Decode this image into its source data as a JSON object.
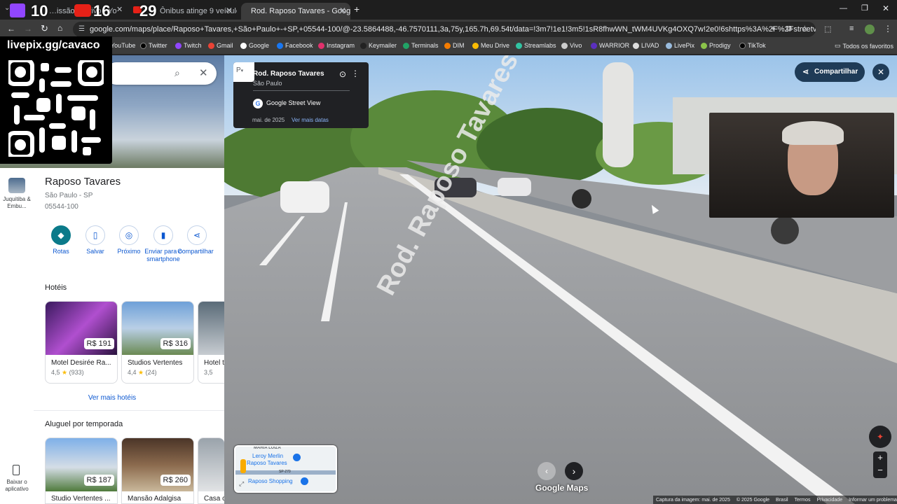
{
  "browser": {
    "tabs": [
      {
        "title": "…issão ao vivo - Yo",
        "active": false
      },
      {
        "title": "Ônibus atinge 9 veículos",
        "active": false
      },
      {
        "title": "Rod. Raposo Tavares - Google",
        "active": true
      }
    ],
    "overlay_counts": [
      "10",
      "16",
      "29"
    ],
    "new_tab": "+",
    "url": "google.com/maps/place/Raposo+Tavares,+São+Paulo+-+SP,+05544-100/@-23.5864488,-46.7570111,3a,75y,165.7h,69.54t/data=!3m7!1e1!3m5!1sR8fhwWN_tWM4UVKg4OXQ7w!2e0!6shttps%3A%2F%2Fstreetviewpixels-pa.googleapis.c...",
    "bookmarks": [
      "YouTube",
      "Twitter",
      "Twitch",
      "Gmail",
      "Google",
      "Facebook",
      "Instagram",
      "Keymailer",
      "Terminals",
      "DIM",
      "Meu Drive",
      "Streamlabs",
      "Vivo",
      "WARRIOR",
      "LIVAD",
      "LivePix",
      "Prodigy",
      "TikTok"
    ],
    "bookmarks_folder": "Todos os favoritos"
  },
  "overlay": {
    "livepix_text": "livepix.gg/cavaco"
  },
  "sidebar": {
    "rail_item": "Juquitiba & Embu...",
    "download_app": "Baixar o aplicativo",
    "place_title": "Raposo Tavares",
    "place_city": "São Paulo - SP",
    "place_cep": "05544-100",
    "actions": [
      "Rotas",
      "Salvar",
      "Próximo",
      "Enviar para o smartphone",
      "Compartilhar"
    ],
    "hotels_heading": "Hotéis",
    "hotels": [
      {
        "name": "Motel Desirée Ra...",
        "price": "R$ 191",
        "rating": "4,5",
        "reviews": "(933)"
      },
      {
        "name": "Studios Vertentes",
        "price": "R$ 316",
        "rating": "4,4",
        "reviews": "(24)"
      },
      {
        "name": "Hotel t",
        "price": "",
        "rating": "3,5",
        "reviews": ""
      }
    ],
    "more_hotels": "Ver mais hotéis",
    "rentals_heading": "Aluguel por temporada",
    "rentals": [
      {
        "name": "Studio Vertentes ...",
        "price": "R$ 187"
      },
      {
        "name": "Mansão Adalgisa",
        "price": "R$ 260"
      },
      {
        "name": "Casa c",
        "price": ""
      }
    ]
  },
  "streetview": {
    "info_road": "Rod. Raposo Tavares",
    "info_city": "São Paulo",
    "info_source": "Google Street View",
    "info_date": "mai. de 2025",
    "info_more_dates": "Ver mais datas",
    "share_label": "Compartilhar",
    "road_paint": "Rod. Raposo Tavares",
    "brand": "Google Maps",
    "minimap_labels": [
      "MARIA LUIZA",
      "Leroy Merlin",
      "Raposo Tavares",
      "SP-270",
      "Raposo Shopping"
    ],
    "footer": [
      "Captura da imagem: mai. de 2025",
      "© 2025 Google",
      "Brasil",
      "Termos",
      "Privacidade",
      "Informar um problema"
    ]
  }
}
